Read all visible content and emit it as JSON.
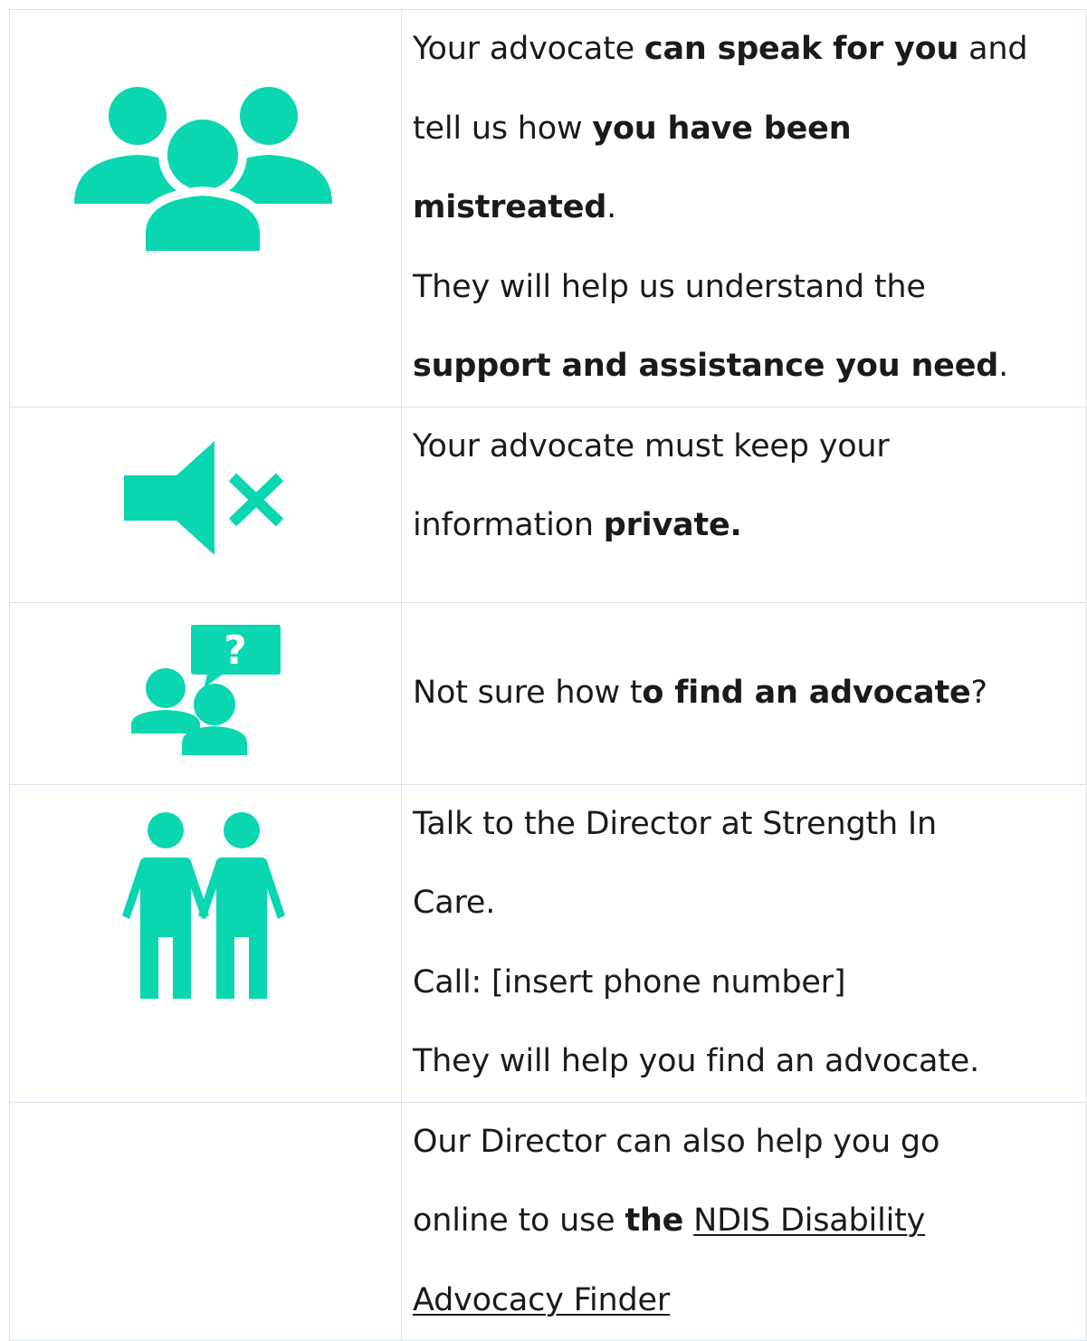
{
  "colors": {
    "icon_teal": "#0ad6b0",
    "border": "#d7e3ef",
    "text": "#1a1a1a"
  },
  "rows": [
    {
      "icon": "group-of-people-icon",
      "lines": [
        {
          "t1": "Your advocate ",
          "b1": "can speak for you",
          "t2": " and"
        },
        {
          "t1": "tell us how ",
          "b1": "you have been"
        },
        {
          "b1": "mistreated",
          "t2": "."
        },
        {
          "t1": "They will help us understand the"
        },
        {
          "b1": "support and assistance you need",
          "t2": "."
        }
      ]
    },
    {
      "icon": "speaker-muted-icon",
      "lines": [
        {
          "t1": "Your advocate must keep your"
        },
        {
          "t1": "information ",
          "b1": "private."
        }
      ]
    },
    {
      "icon": "people-question-speech-icon",
      "lines": [
        {
          "t1": "Not sure how t",
          "b1": "o find an advocate",
          "t2": "?"
        }
      ]
    },
    {
      "icon": "two-people-holding-hands-icon",
      "lines": [
        {
          "t1": "Talk to the Director at Strength In"
        },
        {
          "t1": "Care."
        },
        {
          "t1": "Call: [insert phone number]"
        },
        {
          "t1": "They will help you find an advocate."
        }
      ]
    },
    {
      "icon": "",
      "lines": [
        {
          "t1": "Our Director can also help you go"
        },
        {
          "t1": "online to use ",
          "b1": "the",
          "t2": " ",
          "link1": "NDIS Disability"
        },
        {
          "link1": "Advocacy Finder"
        }
      ]
    }
  ]
}
